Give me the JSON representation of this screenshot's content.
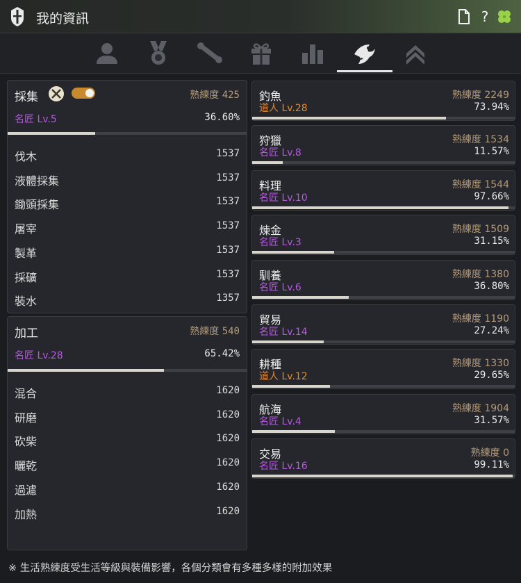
{
  "window": {
    "title": "我的資訊"
  },
  "toolbar": [
    "document-icon",
    "help-icon",
    "clover-icon"
  ],
  "tabs": [
    {
      "name": "profile-tab",
      "icon": "user-icon",
      "active": false
    },
    {
      "name": "medal-tab",
      "icon": "medal-icon",
      "active": false
    },
    {
      "name": "scroll-tab",
      "icon": "scroll-icon",
      "active": false
    },
    {
      "name": "gift-tab",
      "icon": "gift-icon",
      "active": false
    },
    {
      "name": "stats-tab",
      "icon": "bar-chart-icon",
      "active": false
    },
    {
      "name": "life-skill-tab",
      "icon": "fish-icon",
      "active": true
    },
    {
      "name": "rank-tab",
      "icon": "double-chevron-up-icon",
      "active": false
    }
  ],
  "gathering": {
    "title": "採集",
    "proficiency_label": "熟練度",
    "proficiency": "425",
    "level": "名匠 Lv.5",
    "percent": "36.60%",
    "progress": 0.366,
    "toggle_on": true,
    "items": [
      {
        "name": "伐木",
        "value": "1537"
      },
      {
        "name": "液體採集",
        "value": "1537"
      },
      {
        "name": "鋤頭採集",
        "value": "1537"
      },
      {
        "name": "屠宰",
        "value": "1537"
      },
      {
        "name": "製革",
        "value": "1537"
      },
      {
        "name": "採礦",
        "value": "1537"
      },
      {
        "name": "裝水",
        "value": "1357"
      }
    ]
  },
  "processing": {
    "title": "加工",
    "proficiency_label": "熟練度",
    "proficiency": "540",
    "level": "名匠 Lv.28",
    "percent": "65.42%",
    "progress": 0.6542,
    "items": [
      {
        "name": "混合",
        "value": "1620"
      },
      {
        "name": "研磨",
        "value": "1620"
      },
      {
        "name": "砍柴",
        "value": "1620"
      },
      {
        "name": "曬乾",
        "value": "1620"
      },
      {
        "name": "過濾",
        "value": "1620"
      },
      {
        "name": "加熱",
        "value": "1620"
      }
    ]
  },
  "skills": [
    {
      "name": "釣魚",
      "proficiency": "熟練度 2249",
      "level": "道人 Lv.28",
      "rank": "orange",
      "percent": "73.94%",
      "progress": 0.7394
    },
    {
      "name": "狩獵",
      "proficiency": "熟練度 1534",
      "level": "名匠 Lv.8",
      "rank": "purple",
      "percent": "11.57%",
      "progress": 0.1157
    },
    {
      "name": "料理",
      "proficiency": "熟練度 1544",
      "level": "名匠 Lv.10",
      "rank": "purple",
      "percent": "97.66%",
      "progress": 0.9766
    },
    {
      "name": "煉金",
      "proficiency": "熟練度 1509",
      "level": "名匠 Lv.3",
      "rank": "purple",
      "percent": "31.15%",
      "progress": 0.3115
    },
    {
      "name": "馴養",
      "proficiency": "熟練度 1380",
      "level": "名匠 Lv.6",
      "rank": "purple",
      "percent": "36.80%",
      "progress": 0.368
    },
    {
      "name": "貿易",
      "proficiency": "熟練度 1190",
      "level": "名匠 Lv.14",
      "rank": "purple",
      "percent": "27.24%",
      "progress": 0.2724
    },
    {
      "name": "耕種",
      "proficiency": "熟練度 1330",
      "level": "道人 Lv.12",
      "rank": "orange",
      "percent": "29.65%",
      "progress": 0.2965
    },
    {
      "name": "航海",
      "proficiency": "熟練度 1904",
      "level": "名匠 Lv.4",
      "rank": "purple",
      "percent": "31.57%",
      "progress": 0.3157
    },
    {
      "name": "交易",
      "proficiency": "熟練度 0",
      "level": "名匠 Lv.16",
      "rank": "purple",
      "percent": "99.11%",
      "progress": 0.9911
    }
  ],
  "footer": {
    "note": "※ 生活熟練度受生活等級與裝備影響，各個分類會有多種多樣的附加效果"
  },
  "colors": {
    "purple": "#b659e0",
    "orange": "#e08a2e",
    "bar": "#d8d6cc",
    "accent": "#5d7a48"
  }
}
